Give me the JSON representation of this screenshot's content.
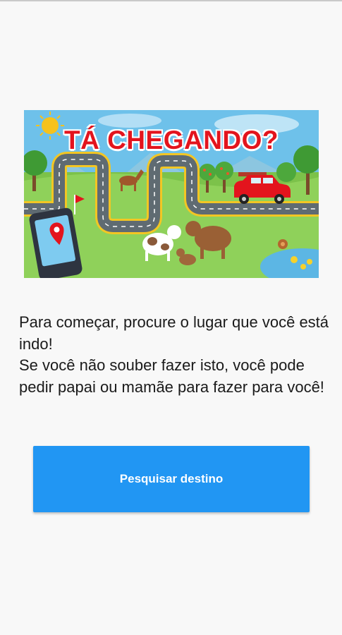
{
  "banner": {
    "title": "TÁ CHEGANDO?",
    "colors": {
      "title": "#e3141d",
      "sky": "#6ec1ea",
      "grass": "#7cc24a",
      "road": "#5f6b72",
      "car": "#e3141d"
    }
  },
  "instructions": {
    "text": "Para começar, procure o lugar que você está indo!\nSe você não souber fazer isto, você pode pedir papai ou mamãe para fazer para você!"
  },
  "search_button": {
    "label": "Pesquisar destino",
    "color": "#2196f3"
  }
}
